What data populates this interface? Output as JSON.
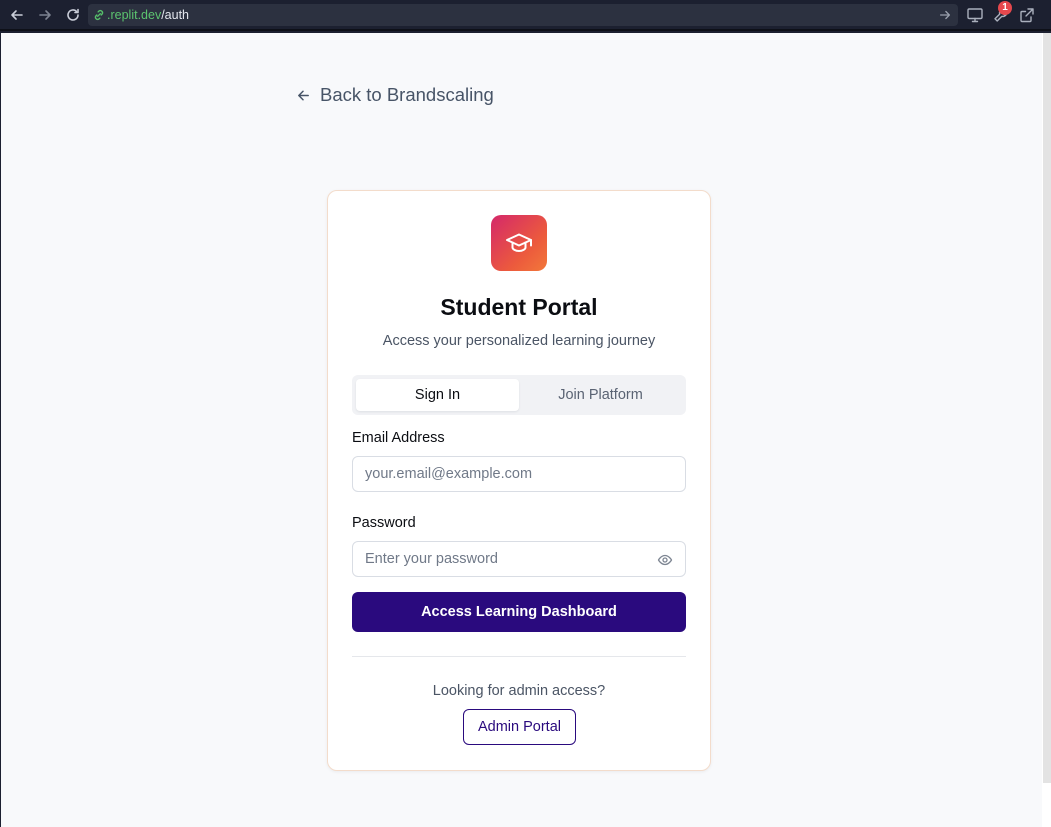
{
  "browser": {
    "url_host": ".replit.dev",
    "url_path": "/auth",
    "notification_count": "1"
  },
  "page": {
    "back_link": "Back to Brandscaling"
  },
  "card": {
    "logo_icon": "graduation-cap-icon",
    "title": "Student Portal",
    "subtitle": "Access your personalized learning journey",
    "tabs": [
      {
        "label": "Sign In",
        "active": true
      },
      {
        "label": "Join Platform",
        "active": false
      }
    ],
    "email": {
      "label": "Email Address",
      "placeholder": "your.email@example.com",
      "value": ""
    },
    "password": {
      "label": "Password",
      "placeholder": "Enter your password",
      "value": ""
    },
    "submit_label": "Access Learning Dashboard",
    "admin_hint": "Looking for admin access?",
    "admin_button": "Admin Portal"
  },
  "colors": {
    "primary": "#2a0a7e",
    "logo_gradient_start": "#d4286a",
    "logo_gradient_end": "#f2783a",
    "url_host": "#5cc46f"
  }
}
